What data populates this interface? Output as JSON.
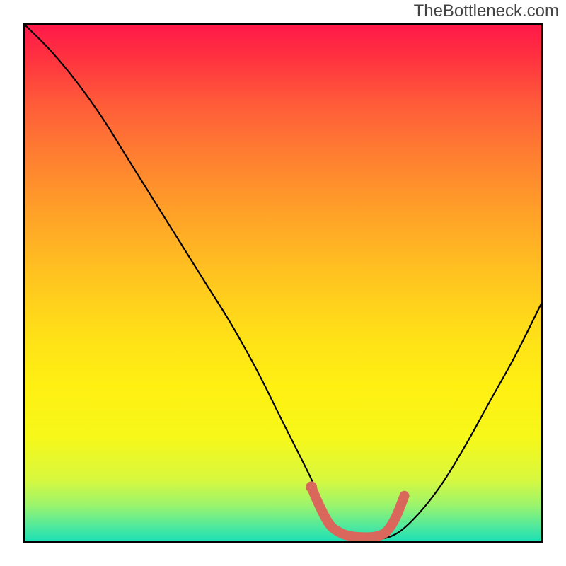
{
  "watermark": "TheBottleneck.com",
  "chart_data": {
    "type": "line",
    "title": "",
    "xlabel": "",
    "ylabel": "",
    "xlim": [
      0,
      100
    ],
    "ylim": [
      0,
      100
    ],
    "series": [
      {
        "name": "primary-curve",
        "x": [
          0,
          5,
          10,
          15,
          20,
          25,
          30,
          35,
          40,
          45,
          50,
          55.5,
          57,
          60,
          63,
          67,
          71,
          75,
          80,
          85,
          90,
          95,
          100
        ],
        "y": [
          100,
          95,
          89,
          82,
          74,
          66,
          58,
          50,
          42,
          33,
          23,
          12,
          8,
          3,
          1,
          0.5,
          1,
          4,
          10,
          18,
          27,
          36,
          46
        ]
      },
      {
        "name": "optimal-band",
        "x": [
          55.5,
          57,
          59,
          61,
          63,
          65,
          67,
          69,
          70.5,
          72,
          73.5
        ],
        "y": [
          10.5,
          7.0,
          3.3,
          1.7,
          1.0,
          0.8,
          0.8,
          1.2,
          2.4,
          5.0,
          8.8
        ]
      }
    ],
    "gradient": {
      "stops": [
        {
          "pos": 0.0,
          "color": "#ff194a"
        },
        {
          "pos": 0.5,
          "color": "#ffd21c"
        },
        {
          "pos": 0.88,
          "color": "#d8f83e"
        },
        {
          "pos": 1.0,
          "color": "#1ce0b4"
        }
      ]
    },
    "grid": false,
    "legend": false
  }
}
